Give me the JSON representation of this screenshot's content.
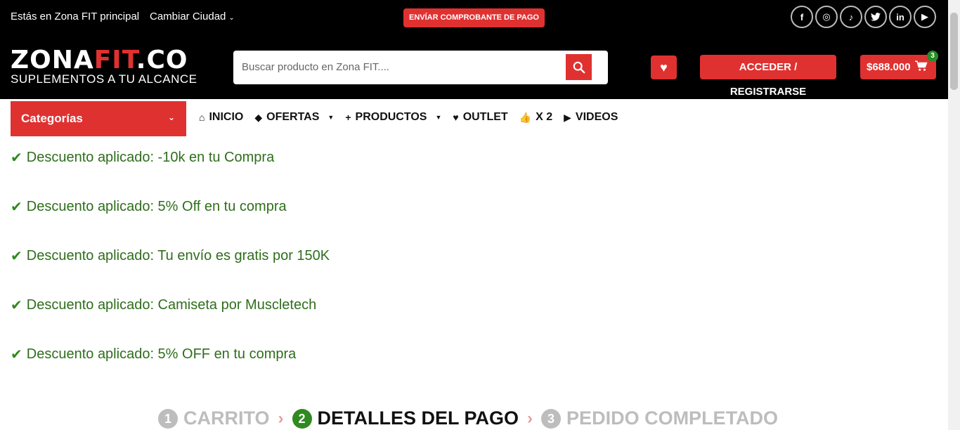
{
  "topbar": {
    "location_text": "Estás en Zona FIT principal",
    "change_city": "Cambiar Ciudad",
    "pay_button": "ENVÍAR COMPROBANTE DE PAGO",
    "socials": [
      {
        "name": "facebook-icon",
        "glyph": "f"
      },
      {
        "name": "instagram-icon",
        "glyph": "◎"
      },
      {
        "name": "tiktok-icon",
        "glyph": "♪"
      },
      {
        "name": "twitter-icon",
        "glyph": "🐦"
      },
      {
        "name": "linkedin-icon",
        "glyph": "in"
      },
      {
        "name": "youtube-icon",
        "glyph": "▶"
      }
    ]
  },
  "header": {
    "logo_main": "ZONA",
    "logo_fit": "FIT",
    "logo_co": ".CO",
    "logo_tagline": "SUPLEMENTOS A TU ALCANCE",
    "search_placeholder": "Buscar producto en Zona FIT....",
    "login_label": "ACCEDER / REGISTRARSE",
    "cart_total": "$688.000",
    "cart_count": "3"
  },
  "nav": {
    "categories_label": "Categorías",
    "items": [
      {
        "label": "INICIO",
        "icon": "⌂"
      },
      {
        "label": "OFERTAS",
        "icon": "◆"
      },
      {
        "label": "PRODUCTOS",
        "icon": "+"
      },
      {
        "label": "OUTLET",
        "icon": "♥"
      },
      {
        "label": "X 2",
        "icon": "👍"
      },
      {
        "label": "VIDEOS",
        "icon": "▶"
      }
    ]
  },
  "notices": [
    "Descuento aplicado: -10k en tu Compra",
    "Descuento aplicado: 5% Off en tu compra",
    "Descuento aplicado: Tu envío es gratis por 150K",
    "Descuento aplicado: Camiseta por Muscletech",
    "Descuento aplicado: 5% OFF en tu compra"
  ],
  "steps": [
    {
      "num": "1",
      "label": "CARRITO"
    },
    {
      "num": "2",
      "label": "DETALLES DEL PAGO"
    },
    {
      "num": "3",
      "label": "PEDIDO COMPLETADO"
    }
  ],
  "colors": {
    "accent": "#e03131",
    "success": "#2f8a1f"
  }
}
